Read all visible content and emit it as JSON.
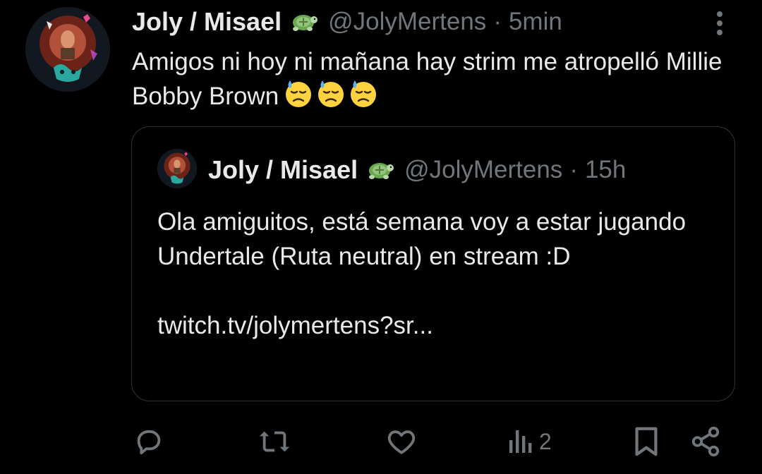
{
  "tweet": {
    "author_name": "Joly / Misael",
    "author_handle": "@JolyMertens",
    "separator": "·",
    "time": "5min",
    "text": "Amigos ni hoy ni mañana hay strim me atropelló Millie Bobby Brown",
    "emoji_names": [
      "downcast-face-with-sweat",
      "downcast-face-with-sweat",
      "downcast-face-with-sweat"
    ]
  },
  "quoted": {
    "author_name": "Joly / Misael",
    "author_handle": "@JolyMertens",
    "separator": "·",
    "time": "15h",
    "text": "Ola amiguitos, está semana voy a estar jugando Undertale (Ruta neutral) en stream :D\n\ntwitch.tv/jolymertens?sr..."
  },
  "actions": {
    "reply_icon": "reply-icon",
    "retweet_icon": "retweet-icon",
    "like_icon": "heart-icon",
    "views_icon": "views-icon",
    "views_count": "2",
    "bookmark_icon": "bookmark-icon",
    "share_icon": "share-icon"
  },
  "colors": {
    "background": "#000000",
    "text_primary": "#e7e9ea",
    "text_secondary": "#71767b",
    "border": "#2f3336"
  }
}
